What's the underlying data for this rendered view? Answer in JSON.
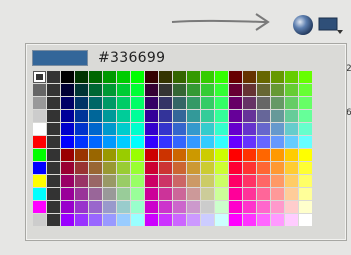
{
  "picker": {
    "current_color": "#336699",
    "hex_label": "#336699"
  },
  "palette": {
    "grayscale": [
      "#333333",
      "#666666",
      "#999999",
      "#cccccc",
      "#ffffff"
    ],
    "special": [
      "#ff0000",
      "#00ff00",
      "#0000ff",
      "#ffff00",
      "#00ffff",
      "#ff00ff"
    ],
    "separator": "#333333",
    "levels": [
      "00",
      "33",
      "66",
      "99",
      "cc",
      "ff"
    ]
  },
  "icons": {
    "arrow": "arrow-right-icon",
    "sphere": "color-sphere-icon",
    "menu": "swatch-menu-icon"
  },
  "side_fragments": [
    "2",
    "6"
  ]
}
